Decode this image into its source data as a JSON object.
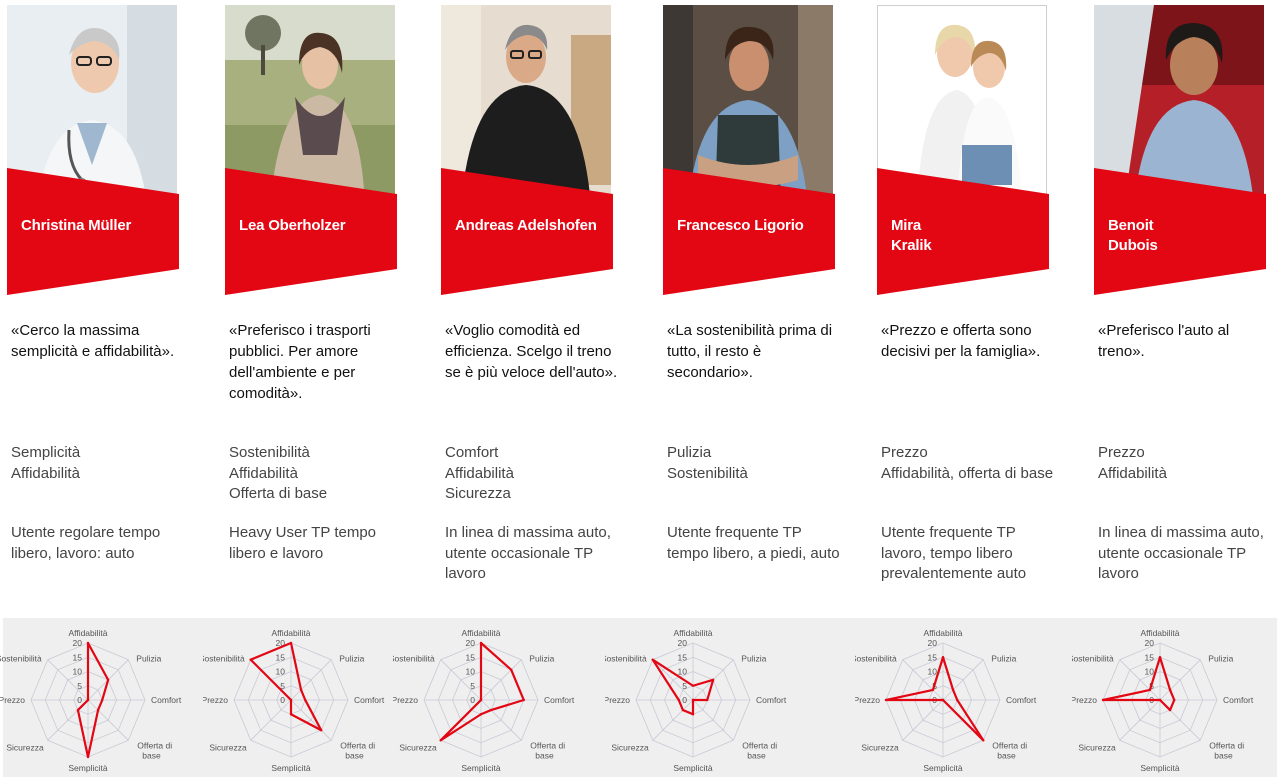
{
  "personas": [
    {
      "name": "Christina Müller",
      "quote": "«Cerco la massima semplicità e affidabilità».",
      "needs": "Semplicità\nAffidabilità",
      "usage": "Utente regolare tempo libero, lavoro: auto",
      "photo_subject": "doctor-with-stethoscope",
      "chart": {
        "Affidabilità": 20,
        "Pulizia": 10,
        "Comfort": 5,
        "Offerta di base": 5,
        "Semplicità": 20,
        "Sicurezza": 5,
        "Prezzo": 0,
        "Sostenibilità": 0
      }
    },
    {
      "name": "Lea Oberholzer",
      "quote": "«Preferisco i trasporti pubblici. Per amore dell'ambiente e per comodità».",
      "needs": "Sostenibilità\nAffidabilità\nOfferta di base",
      "usage": "Heavy User TP tempo libero e lavoro",
      "photo_subject": "woman-with-scarf-outdoors",
      "chart": {
        "Affidabilità": 20,
        "Pulizia": 5,
        "Comfort": 5,
        "Offerta di base": 15,
        "Semplicità": 5,
        "Sicurezza": 0,
        "Prezzo": 0,
        "Sostenibilità": 20
      }
    },
    {
      "name": "Andreas Adelshofen",
      "quote": "«Voglio comodità ed efficienza. Scelgo il treno se è più veloce dell'auto».",
      "needs": "Comfort\nAffidabilità\nSicurezza",
      "usage": "In linea di massima auto, utente occasionale TP lavoro",
      "photo_subject": "man-in-black-sweater",
      "chart": {
        "Affidabilità": 20,
        "Pulizia": 15,
        "Comfort": 15,
        "Offerta di base": 5,
        "Semplicità": 5,
        "Sicurezza": 20,
        "Prezzo": 0,
        "Sostenibilità": 0
      }
    },
    {
      "name": "Francesco Ligorio",
      "quote": "«La sostenibilità prima di tutto, il resto è secondario».",
      "needs": "Pulizia\nSostenibilità",
      "usage": "Utente frequente TP tempo libero, a piedi, auto",
      "photo_subject": "man-with-apron",
      "chart": {
        "Affidabilità": 5,
        "Pulizia": 10,
        "Comfort": 5,
        "Offerta di base": 0,
        "Semplicità": 5,
        "Sicurezza": 5,
        "Prezzo": 5,
        "Sostenibilità": 20
      }
    },
    {
      "name": "Mira Kralik",
      "quote": "«Prezzo e offerta sono decisivi per la famiglia».",
      "needs": "Prezzo\nAffidabilità, offerta di base",
      "usage": "Utente frequente TP lavoro, tempo libero prevalentemente auto",
      "photo_subject": "mother-and-daughter",
      "chart": {
        "Affidabilità": 15,
        "Pulizia": 5,
        "Comfort": 5,
        "Offerta di base": 20,
        "Semplicità": 0,
        "Sicurezza": 0,
        "Prezzo": 20,
        "Sostenibilità": 5
      }
    },
    {
      "name": "Benoit Dubois",
      "quote": "«Preferisco l'auto al treno».",
      "needs": "Prezzo\nAffidabilità",
      "usage": "In linea di massima auto, utente occasionale TP lavoro",
      "photo_subject": "man-in-car",
      "chart": {
        "Affidabilità": 15,
        "Pulizia": 5,
        "Comfort": 5,
        "Offerta di base": 5,
        "Semplicità": 0,
        "Sicurezza": 0,
        "Prezzo": 20,
        "Sostenibilità": 5
      }
    }
  ],
  "radar_axes": [
    "Affidabilità",
    "Pulizia",
    "Comfort",
    "Offerta di base",
    "Semplicità",
    "Sicurezza",
    "Prezzo",
    "Sostenibilità"
  ],
  "radar_ticks": [
    "20",
    "15",
    "10",
    "5",
    "0"
  ],
  "chart_data": [
    {
      "type": "radar",
      "categories": [
        "Affidabilità",
        "Pulizia",
        "Comfort",
        "Offerta di base",
        "Semplicità",
        "Sicurezza",
        "Prezzo",
        "Sostenibilità"
      ],
      "values": [
        20,
        10,
        5,
        5,
        20,
        5,
        0,
        0
      ],
      "ylim": [
        0,
        20
      ]
    },
    {
      "type": "radar",
      "categories": [
        "Affidabilità",
        "Pulizia",
        "Comfort",
        "Offerta di base",
        "Semplicità",
        "Sicurezza",
        "Prezzo",
        "Sostenibilità"
      ],
      "values": [
        20,
        5,
        5,
        15,
        5,
        0,
        0,
        20
      ],
      "ylim": [
        0,
        20
      ]
    },
    {
      "type": "radar",
      "categories": [
        "Affidabilità",
        "Pulizia",
        "Comfort",
        "Offerta di base",
        "Semplicità",
        "Sicurezza",
        "Prezzo",
        "Sostenibilità"
      ],
      "values": [
        20,
        15,
        15,
        5,
        5,
        20,
        0,
        0
      ],
      "ylim": [
        0,
        20
      ]
    },
    {
      "type": "radar",
      "categories": [
        "Affidabilità",
        "Pulizia",
        "Comfort",
        "Offerta di base",
        "Semplicità",
        "Sicurezza",
        "Prezzo",
        "Sostenibilità"
      ],
      "values": [
        5,
        10,
        5,
        0,
        5,
        5,
        5,
        20
      ],
      "ylim": [
        0,
        20
      ]
    },
    {
      "type": "radar",
      "categories": [
        "Affidabilità",
        "Pulizia",
        "Comfort",
        "Offerta di base",
        "Semplicità",
        "Sicurezza",
        "Prezzo",
        "Sostenibilità"
      ],
      "values": [
        15,
        5,
        5,
        20,
        0,
        0,
        20,
        5
      ],
      "ylim": [
        0,
        20
      ]
    },
    {
      "type": "radar",
      "categories": [
        "Affidabilità",
        "Pulizia",
        "Comfort",
        "Offerta di base",
        "Semplicità",
        "Sicurezza",
        "Prezzo",
        "Sostenibilità"
      ],
      "values": [
        15,
        5,
        5,
        5,
        0,
        0,
        20,
        5
      ],
      "ylim": [
        0,
        20
      ]
    }
  ],
  "colors": {
    "brand_red": "#e30613",
    "radar_line": "#e30613",
    "radar_grid": "#c9c9d6"
  }
}
